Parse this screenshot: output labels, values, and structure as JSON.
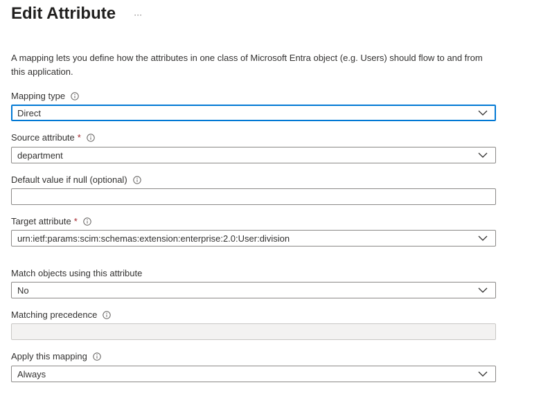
{
  "header": {
    "title": "Edit Attribute",
    "more_label": "···"
  },
  "description": "A mapping lets you define how the attributes in one class of Microsoft Entra object (e.g. Users) should flow to and from this application.",
  "fields": {
    "mapping_type": {
      "label": "Mapping type",
      "value": "Direct"
    },
    "source_attribute": {
      "label": "Source attribute",
      "required_mark": "*",
      "value": "department"
    },
    "default_value": {
      "label": "Default value if null (optional)",
      "value": ""
    },
    "target_attribute": {
      "label": "Target attribute",
      "required_mark": "*",
      "value": "urn:ietf:params:scim:schemas:extension:enterprise:2.0:User:division"
    },
    "match_objects": {
      "label": "Match objects using this attribute",
      "value": "No"
    },
    "matching_precedence": {
      "label": "Matching precedence",
      "value": ""
    },
    "apply_mapping": {
      "label": "Apply this mapping",
      "value": "Always"
    }
  },
  "colors": {
    "focus_border": "#0078d4",
    "required": "#a4262c",
    "disabled_bg": "#f3f2f1"
  },
  "icons": {
    "info": "info-icon",
    "dropdown": "chevron-down-icon",
    "more": "more-icon"
  }
}
